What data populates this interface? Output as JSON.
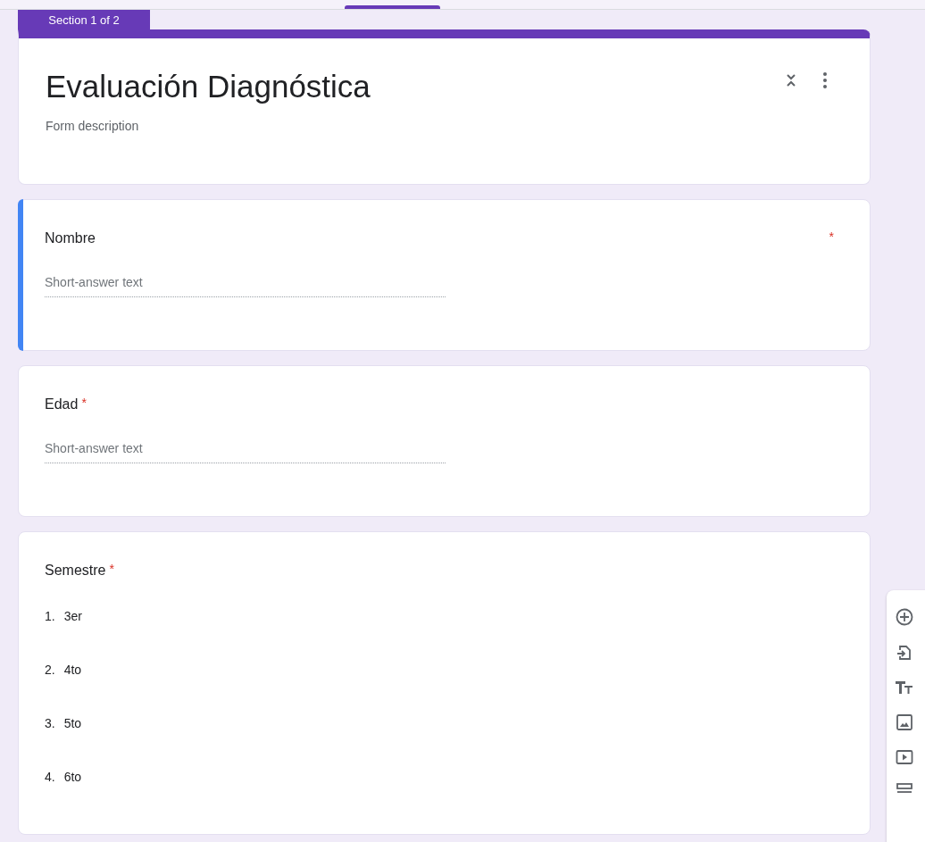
{
  "section_tab": {
    "label": "Section 1 of 2"
  },
  "form": {
    "title": "Evaluación Diagnóstica",
    "description_placeholder": "Form description"
  },
  "questions": [
    {
      "kind": "short",
      "title": "Nombre",
      "required": true,
      "required_mark": "*",
      "focused": true,
      "placeholder": "Short-answer text"
    },
    {
      "kind": "short",
      "title": "Edad",
      "required": true,
      "required_mark": "*",
      "focused": false,
      "placeholder": "Short-answer text"
    },
    {
      "kind": "list",
      "title": "Semestre",
      "required": true,
      "required_mark": "*",
      "focused": false,
      "options": [
        {
          "number": "1.",
          "label": "3er"
        },
        {
          "number": "2.",
          "label": "4to"
        },
        {
          "number": "3.",
          "label": "5to"
        },
        {
          "number": "4.",
          "label": "6to"
        }
      ]
    }
  ]
}
